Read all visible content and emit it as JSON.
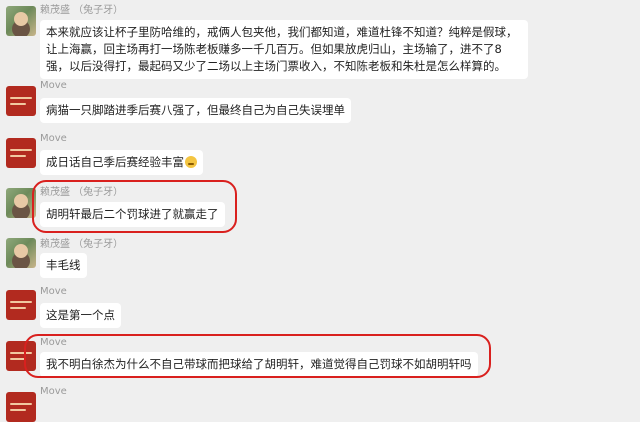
{
  "messages": [
    {
      "sender": "赖茂盛 （兔子牙）",
      "text": "本来就应该让杯子里防哈维的，戒俩人包夹他，我们都知道，难道杜锋不知道？纯粹是假球，让上海赢，回主场再打一场陈老板赚多一千几百万。但如果放虎归山，主场输了，进不了8强，以后没得打，最起码又少了二场以上主场门票收入，不知陈老板和朱杜是怎么样算的。"
    },
    {
      "sender": "Move",
      "text": "病猫一只脚踏进季后赛八强了，但最终自己为自己失误埋单"
    },
    {
      "sender": "Move",
      "text": "成日话自己季后赛经验丰富",
      "emoji": "awkward-smile-emoji"
    },
    {
      "sender": "赖茂盛 （兔子牙）",
      "text": "胡明轩最后二个罚球进了就赢走了"
    },
    {
      "sender": "赖茂盛 （兔子牙）",
      "text": "丰毛线"
    },
    {
      "sender": "Move",
      "text": "这是第一个点"
    },
    {
      "sender": "Move",
      "text": "我不明白徐杰为什么不自己带球而把球给了胡明轩，难道觉得自己罚球不如胡明轩吗"
    },
    {
      "sender": "Move",
      "text": ""
    }
  ],
  "highlight_color": "#d9201e"
}
